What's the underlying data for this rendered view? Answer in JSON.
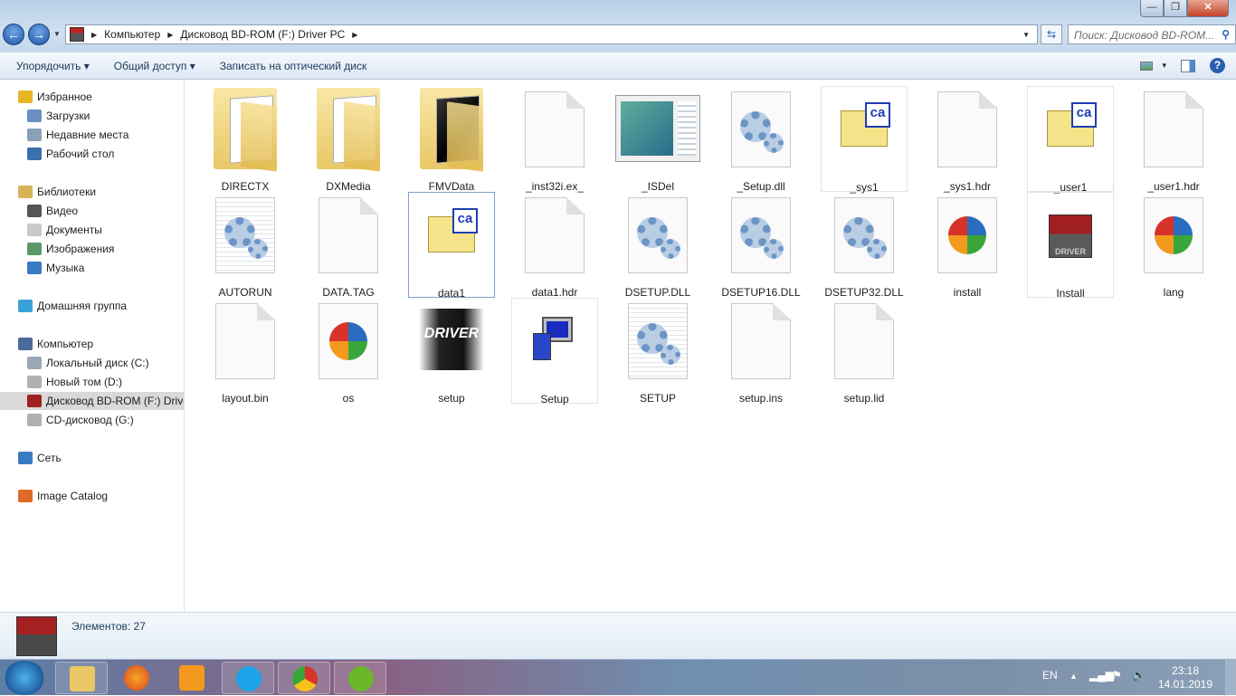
{
  "window": {
    "minimize": "—",
    "maximize": "❐",
    "close": "✕"
  },
  "nav": {
    "back": "←",
    "forward": "→"
  },
  "address": {
    "crumbs": [
      "Компьютер",
      "Дисковод BD-ROM (F:) Driver PC"
    ]
  },
  "search": {
    "placeholder": "Поиск: Дисковод BD-ROM...",
    "icon": "search-icon"
  },
  "toolbar": {
    "organize": "Упорядочить ▾",
    "share": "Общий доступ ▾",
    "burn": "Записать на оптический диск",
    "views": "▾",
    "help": "?"
  },
  "sidebar": [
    {
      "label": "Избранное",
      "icon": "star",
      "indent": 0,
      "color": "#e8b526"
    },
    {
      "label": "Загрузки",
      "icon": "downloads",
      "indent": 1,
      "color": "#6a8fc2"
    },
    {
      "label": "Недавние места",
      "icon": "recent",
      "indent": 1,
      "color": "#8aa0b8"
    },
    {
      "label": "Рабочий стол",
      "icon": "desktop",
      "indent": 1,
      "color": "#3a6fb0"
    },
    {
      "label": "Библиотеки",
      "icon": "libraries",
      "indent": 0,
      "color": "#d9b35a"
    },
    {
      "label": "Видео",
      "icon": "video",
      "indent": 1,
      "color": "#555"
    },
    {
      "label": "Документы",
      "icon": "documents",
      "indent": 1,
      "color": "#c9c9c9"
    },
    {
      "label": "Изображения",
      "icon": "pictures",
      "indent": 1,
      "color": "#5a9a6a"
    },
    {
      "label": "Музыка",
      "icon": "music",
      "indent": 1,
      "color": "#3a7ac2"
    },
    {
      "label": "Домашняя группа",
      "icon": "homegroup",
      "indent": 0,
      "color": "#3aa0d8"
    },
    {
      "label": "Компьютер",
      "icon": "computer",
      "indent": 0,
      "color": "#4a6a9a"
    },
    {
      "label": "Локальный диск (C:)",
      "icon": "drive",
      "indent": 1,
      "color": "#9aa8b8"
    },
    {
      "label": "Новый том (D:)",
      "icon": "drive",
      "indent": 1,
      "color": "#b0b0b0"
    },
    {
      "label": "Дисковод BD-ROM (F:) Driver PC",
      "icon": "driver-disc",
      "indent": 1,
      "color": "#a02020",
      "selected": true
    },
    {
      "label": "CD-дисковод (G:)",
      "icon": "cd-drive",
      "indent": 1,
      "color": "#b0b0b0"
    },
    {
      "label": "Сеть",
      "icon": "network",
      "indent": 0,
      "color": "#3a7ac2"
    },
    {
      "label": "Image Catalog",
      "icon": "image-catalog",
      "indent": 0,
      "color": "#e06a2a"
    }
  ],
  "files": [
    {
      "name": "DIRECTX",
      "type": "folder"
    },
    {
      "name": "DXMedia",
      "type": "folder"
    },
    {
      "name": "FMVData",
      "type": "folder-dark"
    },
    {
      "name": "_inst32i.ex_",
      "type": "blank"
    },
    {
      "name": "_ISDel",
      "type": "isdel"
    },
    {
      "name": "_Setup.dll",
      "type": "gear"
    },
    {
      "name": "_sys1",
      "type": "ca"
    },
    {
      "name": "_sys1.hdr",
      "type": "blank"
    },
    {
      "name": "_user1",
      "type": "ca"
    },
    {
      "name": "_user1.hdr",
      "type": "blank"
    },
    {
      "name": "AUTORUN",
      "type": "gear-lined"
    },
    {
      "name": "DATA.TAG",
      "type": "blank"
    },
    {
      "name": "data1",
      "type": "ca",
      "selected": true
    },
    {
      "name": "data1.hdr",
      "type": "blank"
    },
    {
      "name": "DSETUP.DLL",
      "type": "gear"
    },
    {
      "name": "DSETUP16.DLL",
      "type": "gear"
    },
    {
      "name": "DSETUP32.DLL",
      "type": "gear"
    },
    {
      "name": "install",
      "type": "inst"
    },
    {
      "name": "Install",
      "type": "drv"
    },
    {
      "name": "lang",
      "type": "inst"
    },
    {
      "name": "layout.bin",
      "type": "blank"
    },
    {
      "name": "os",
      "type": "inst"
    },
    {
      "name": "setup",
      "type": "setupimg"
    },
    {
      "name": "Setup",
      "type": "pc"
    },
    {
      "name": "SETUP",
      "type": "gear-lined"
    },
    {
      "name": "setup.ins",
      "type": "blank"
    },
    {
      "name": "setup.lid",
      "type": "blank"
    }
  ],
  "status": {
    "count": "Элементов: 27"
  },
  "taskbar": {
    "apps": [
      "explorer",
      "firefox",
      "media-player",
      "skype",
      "chrome",
      "utorrent"
    ],
    "lang": "EN",
    "time": "23:18",
    "date": "14.01.2019"
  }
}
